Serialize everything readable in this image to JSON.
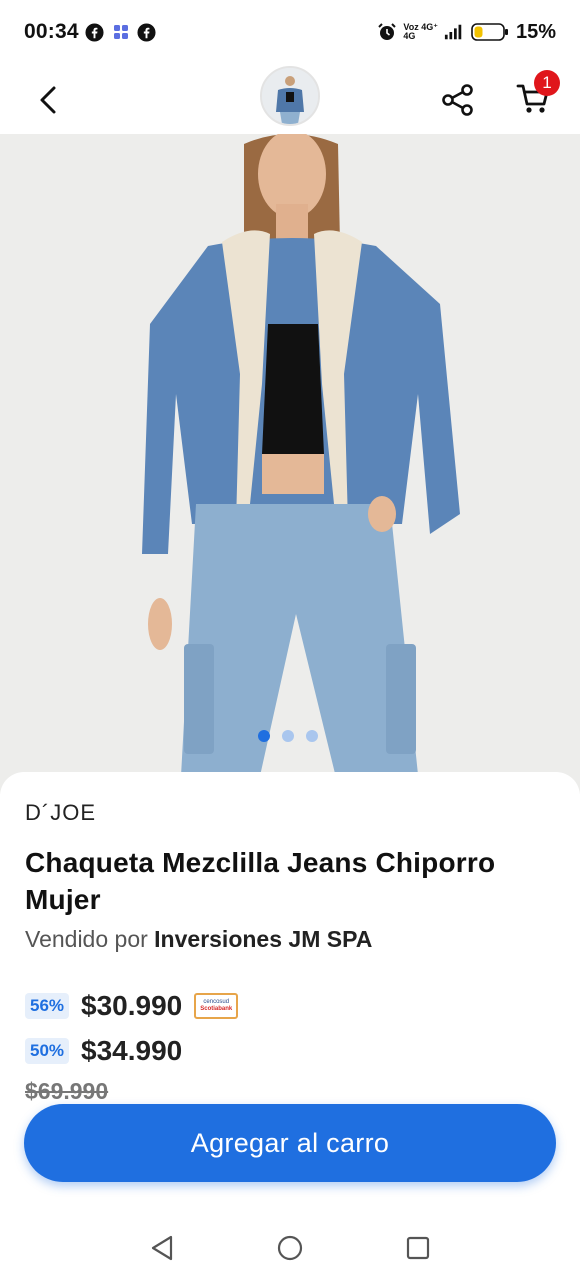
{
  "status_bar": {
    "time": "00:34",
    "network_line1": "Voz 4G⁺",
    "network_line2": "4G",
    "battery_percent": "15%"
  },
  "nav": {
    "cart_count": "1"
  },
  "carousel": {
    "total_images": 3,
    "active_index": 0
  },
  "product": {
    "brand": "D´JOE",
    "title": "Chaqueta Mezclilla Jeans Chiporro Mujer",
    "sold_by_prefix": "Vendido por ",
    "seller": "Inversiones JM SPA",
    "card_price_discount": "56%",
    "card_price": "$30.990",
    "card_logo_line1": "cencosud",
    "card_logo_line2": "Scotiabank",
    "internet_price_discount": "50%",
    "internet_price": "$34.990",
    "normal_price": "$69.990"
  },
  "actions": {
    "add_to_cart_label": "Agregar al carro"
  },
  "colors": {
    "accent": "#1f6fe0",
    "badge_bg": "#e6effb",
    "cart_badge": "#e0161b"
  }
}
